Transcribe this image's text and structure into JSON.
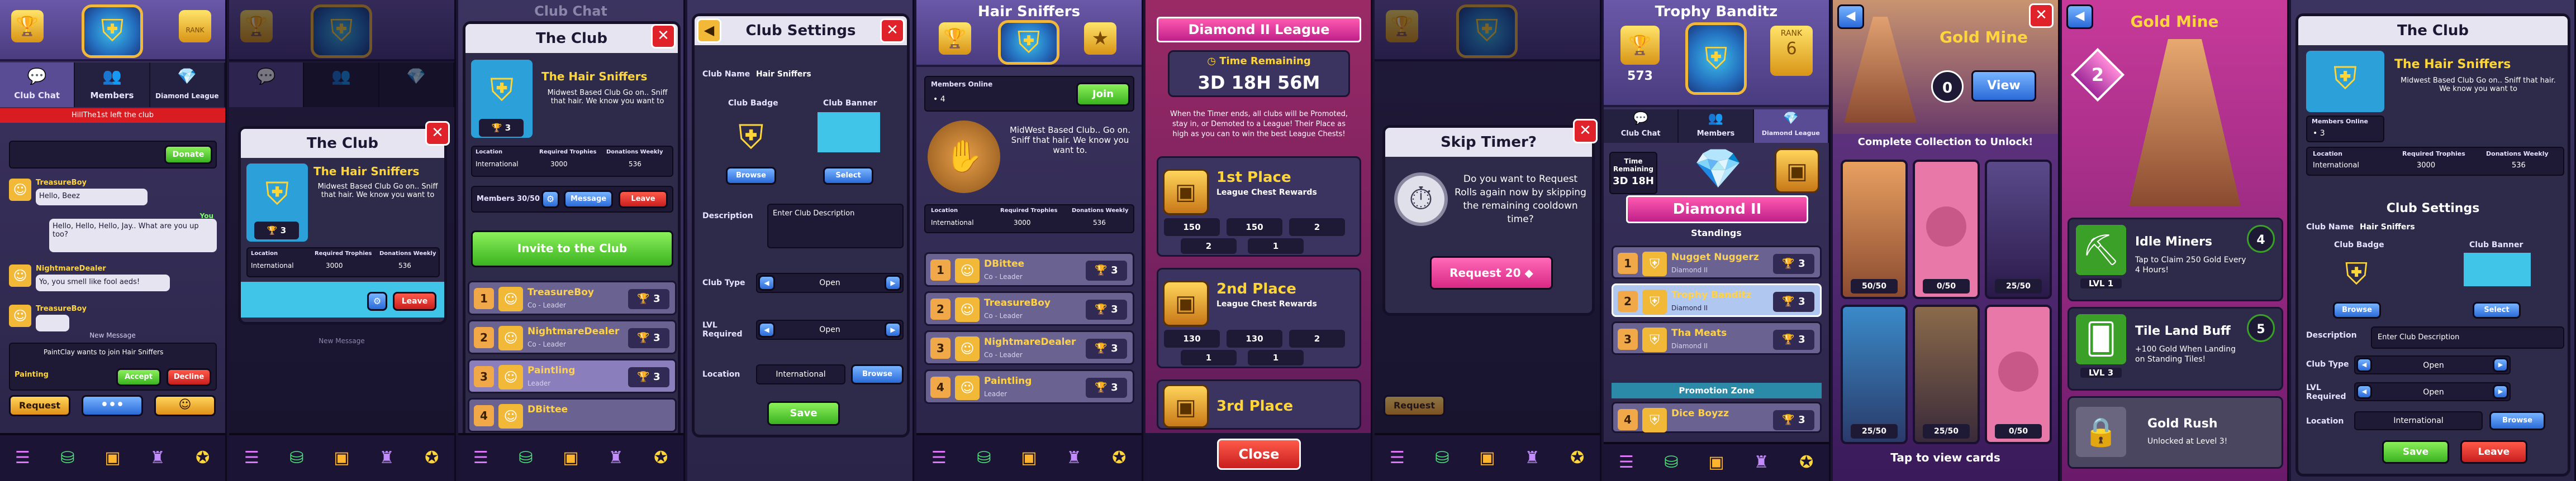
{
  "colors": {
    "accent": "#5a4c94",
    "green": "#3ab220",
    "red": "#c81e1e",
    "gold": "#ffd63a",
    "pink": "#d82884"
  },
  "tabs": {
    "chat": "Club Chat",
    "members": "Members",
    "league": "Diamond League"
  },
  "nav_icons": [
    "menu-icon",
    "shop-icon",
    "chest-icon",
    "club-icon",
    "trophy-icon"
  ],
  "p1": {
    "rank_badge": "RANK",
    "trophy_count": "",
    "alert": "HillThe1st left the club",
    "donate": "Donate",
    "messages": [
      {
        "name": "TreasureBoy",
        "text": "Hello, Beez"
      },
      {
        "name": "TreasureBoy",
        "text": "Hello, Hello, Hello, Jay.. What are you up too?"
      },
      {
        "name": "NightmareDealer",
        "text": "Yo, you smell like fool aeds!"
      },
      {
        "name": "TreasureBoy",
        "text": ""
      }
    ],
    "me_label": "You",
    "new_message": "New Message",
    "join_notice": "PaintClay wants to join Hair Sniffers",
    "accept": "Accept",
    "decline": "Decline",
    "request": "Request",
    "painting": "Painting"
  },
  "p2": {
    "title": "The Club",
    "club_name": "The Hair Sniffers",
    "desc": "Midwest Based Club Go on.. Sniff that hair. We know you want to",
    "trophies": "3",
    "loc_label": "Location",
    "loc_val": "International",
    "req_label": "Required Trophies",
    "req_val": "3000",
    "don_label": "Donations Weekly",
    "don_val": "536",
    "leave": "Leave",
    "new_message": "New Message"
  },
  "p3": {
    "title": "The Club",
    "header_bg": "Club Chat",
    "club_name": "The Hair Sniffers",
    "desc": "Midwest Based Club Go on.. Sniff that hair. We know you want to",
    "trophies": "3",
    "loc_label": "Location",
    "loc_val": "International",
    "req_label": "Required Trophies",
    "req_val": "3000",
    "don_label": "Donations Weekly",
    "don_val": "536",
    "members_label": "Members",
    "members_count": "30/50",
    "message": "Message",
    "leave": "Leave",
    "invite": "Invite to the Club",
    "members": [
      {
        "rank": "1",
        "name": "TreasureBoy",
        "role": "Co - Leader",
        "tro": "3"
      },
      {
        "rank": "2",
        "name": "NightmareDealer",
        "role": "Co - Leader",
        "tro": "3"
      },
      {
        "rank": "3",
        "name": "Paintling",
        "role": "Leader",
        "tro": "3"
      },
      {
        "rank": "4",
        "name": "DBittee",
        "role": "",
        "tro": ""
      }
    ]
  },
  "p4": {
    "title": "Club Settings",
    "name_label": "Club Name",
    "name_val": "Hair Sniffers",
    "badge_label": "Club Badge",
    "banner_label": "Club Banner",
    "browse": "Browse",
    "select": "Select",
    "desc_label": "Description",
    "desc_ph": "Enter Club Description",
    "type_label": "Club Type",
    "type_val": "Open",
    "lvl_label": "LVL Required",
    "lvl_val": "Open",
    "loc_label": "Location",
    "loc_val": "International",
    "save": "Save"
  },
  "p5": {
    "title": "Hair Sniffers",
    "online_label": "Members Online",
    "online_val": "4",
    "join": "Join",
    "desc": "MidWest Based Club.. Go on. Sniff that hair. We know you want to.",
    "loc_label": "Location",
    "loc_val": "International",
    "req_label": "Required Trophies",
    "req_val": "3000",
    "don_label": "Donations Weekly",
    "don_val": "536",
    "members": [
      {
        "rank": "1",
        "name": "DBittee",
        "role": "Co - Leader",
        "tro": "3"
      },
      {
        "rank": "2",
        "name": "TreasureBoy",
        "role": "Co - Leader",
        "tro": "3"
      },
      {
        "rank": "3",
        "name": "NightmareDealer",
        "role": "Co - Leader",
        "tro": "3"
      },
      {
        "rank": "4",
        "name": "Paintling",
        "role": "Leader",
        "tro": "3"
      }
    ]
  },
  "p6": {
    "title": "Diamond II League",
    "time_label": "Time Remaining",
    "time_val": "3D 18H 56M",
    "info": "When the Timer ends, all clubs will be Promoted, stay in, or Demoted to a League! Their Place as high as you can to win the best League Chests!",
    "places": [
      {
        "place": "1st Place",
        "sub": "League Chest Rewards",
        "r": [
          "150",
          "150",
          "2",
          "2",
          "1"
        ]
      },
      {
        "place": "2nd Place",
        "sub": "League Chest Rewards",
        "r": [
          "130",
          "130",
          "2",
          "1",
          "1"
        ]
      },
      {
        "place": "3rd Place",
        "sub": "",
        "r": []
      }
    ],
    "close": "Close"
  },
  "p7": {
    "title": "Skip Timer?",
    "body": "Do you want to Request Rolls again now by skipping the remaining cooldown time?",
    "button": "Request 20",
    "request": "Request"
  },
  "p8": {
    "title": "Trophy Banditz",
    "trophies": "573",
    "rank_label": "RANK",
    "rank_val": "6",
    "time_label": "Time Remaining",
    "time_val": "3D 18H",
    "league": "Diamond II",
    "standings": "Standings",
    "promotion": "Promotion Zone",
    "rows": [
      {
        "rank": "1",
        "name": "Nugget Nuggerz",
        "sub": "Diamond II",
        "tro": "3"
      },
      {
        "rank": "2",
        "name": "Trophy Banditz",
        "sub": "Diamond II",
        "tro": "3"
      },
      {
        "rank": "3",
        "name": "Tha Meats",
        "sub": "Diamond II",
        "tro": "3"
      },
      {
        "rank": "4",
        "name": "Dice Boyzz",
        "sub": "",
        "tro": "3"
      }
    ]
  },
  "p9": {
    "title": "Gold Mine",
    "count": "0",
    "view": "View",
    "complete": "Complete Collection to Unlock!",
    "cards": [
      "50/50",
      "0/50",
      "25/50",
      "25/50",
      "25/50",
      "0/50"
    ],
    "tap": "Tap to view cards"
  },
  "p10": {
    "title": "Gold Mine",
    "level": "2",
    "items": [
      {
        "name": "Idle Miners",
        "desc": "Tap to Claim 250 Gold Every 4 Hours!",
        "lvl": "LVL 1",
        "n": "4"
      },
      {
        "name": "Tile Land Buff",
        "desc": "+100 Gold When Landing on Standing Tiles!",
        "lvl": "LVL 3",
        "n": "5"
      },
      {
        "name": "Gold Rush",
        "desc": "Unlocked at Level 3!",
        "lvl": "",
        "n": ""
      }
    ]
  },
  "p11": {
    "title": "The Club",
    "club_name": "The Hair Sniffers",
    "desc": "Midwest Based Club Go on.. Sniff that hair. We know you want to",
    "online_label": "Members Online",
    "online_val": "3",
    "loc_label": "Location",
    "loc_val": "International",
    "req_label": "Required Trophies",
    "req_val": "3000",
    "don_label": "Donations Weekly",
    "don_val": "536",
    "settings": "Club Settings",
    "name_label": "Club Name",
    "name_val": "Hair Sniffers",
    "badge_label": "Club Badge",
    "banner_label": "Club Banner",
    "browse": "Browse",
    "select": "Select",
    "desc_label": "Description",
    "desc_ph": "Enter Club Description",
    "type_label": "Club Type",
    "type_val": "Open",
    "lvl_label": "LVL Required",
    "lvl_val": "Open",
    "loc2_label": "Location",
    "loc2_val": "International",
    "save": "Save",
    "leave": "Leave"
  }
}
